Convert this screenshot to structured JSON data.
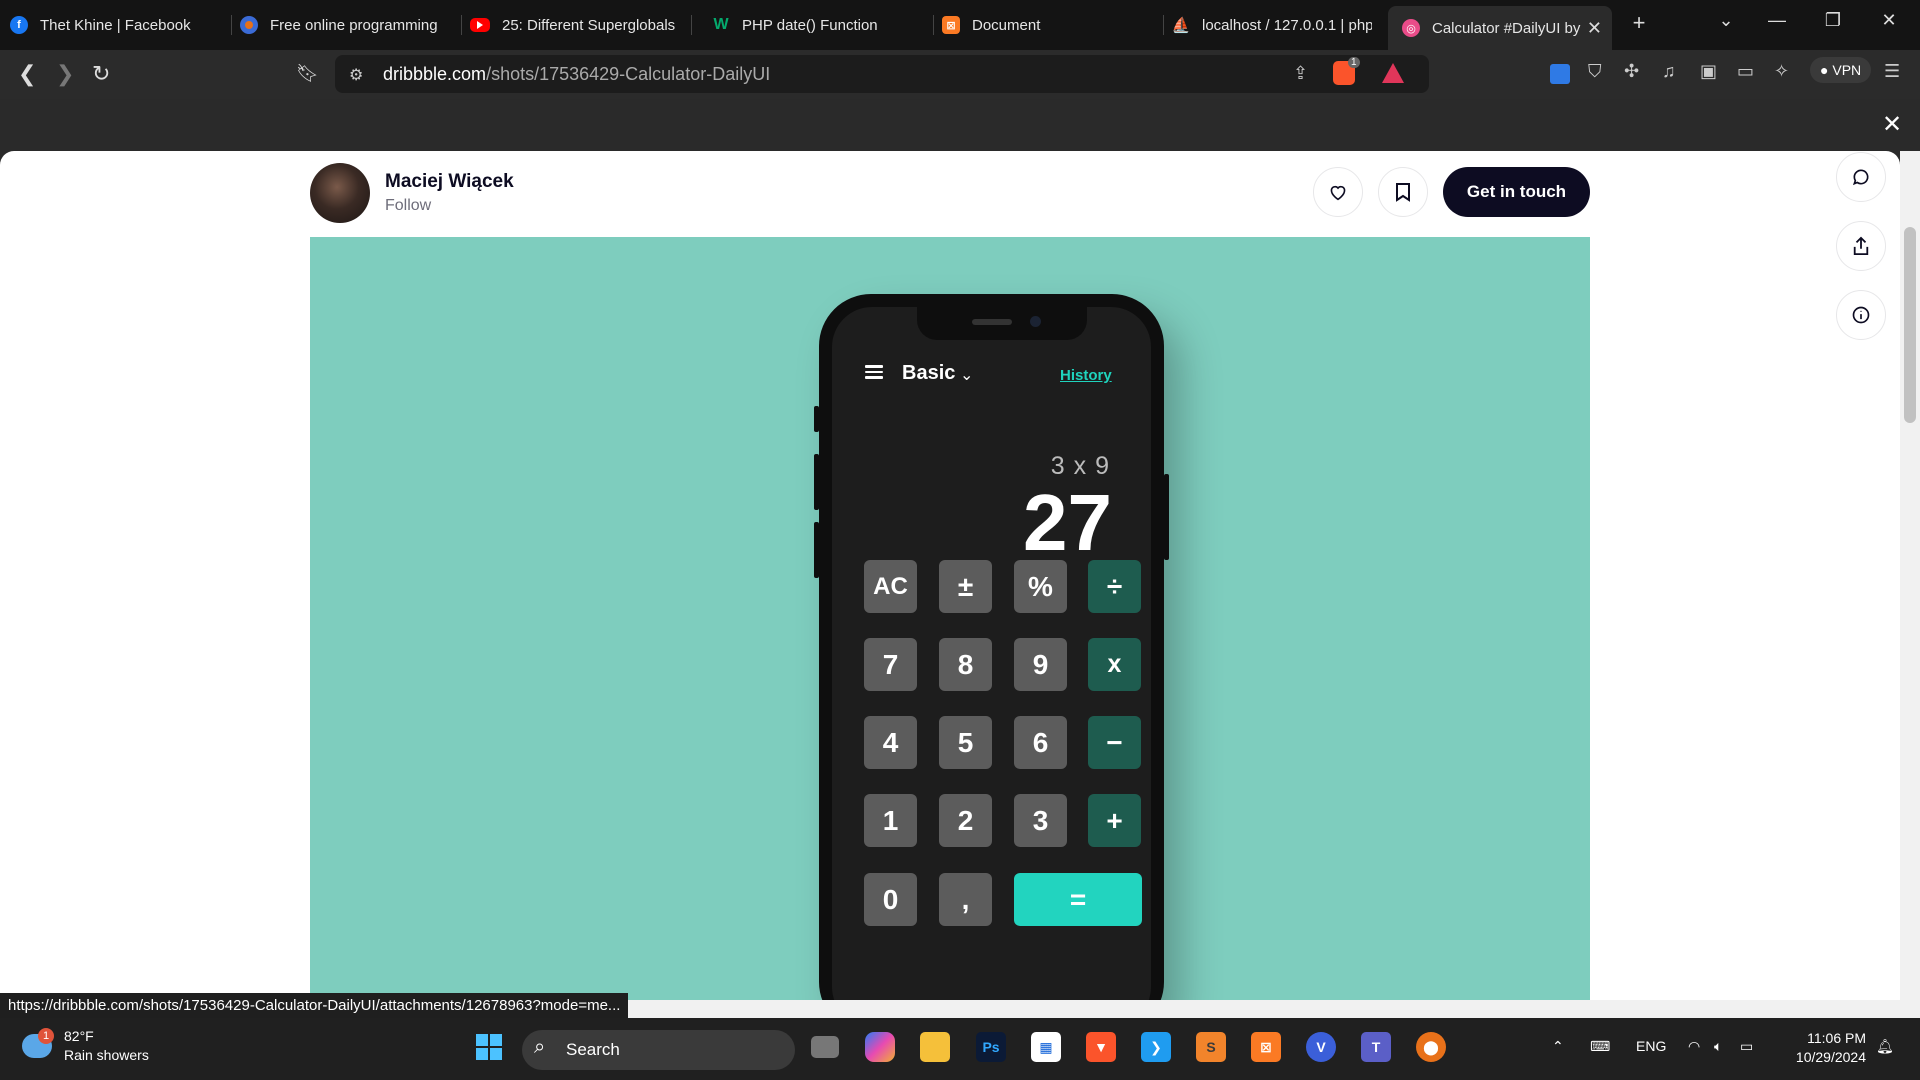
{
  "browser": {
    "tabs": [
      {
        "title": "Thet Khine | Facebook",
        "icon": "facebook-icon",
        "color": "#1877f2"
      },
      {
        "title": "Free online programming",
        "icon": "globe-icon",
        "color": "#e8711a"
      },
      {
        "title": "25: Different Superglobals",
        "icon": "youtube-icon",
        "color": "#ff0000"
      },
      {
        "title": "PHP date() Function",
        "icon": "w3schools-icon",
        "color": "#04aa6d"
      },
      {
        "title": "Document",
        "icon": "xampp-icon",
        "color": "#fb7a24"
      },
      {
        "title": "localhost / 127.0.0.1 | php",
        "icon": "phpmyadmin-icon",
        "color": "#f89c0e"
      },
      {
        "title": "Calculator #DailyUI by",
        "icon": "dribbble-icon",
        "color": "#ea4c89"
      }
    ],
    "url_host": "dribbble.com",
    "url_path": "/shots/17536429-Calculator-DailyUI",
    "shields_badge": "1",
    "vpn_label": "VPN",
    "status_url": "https://dribbble.com/shots/17536429-Calculator-DailyUI/attachments/12678963?mode=me..."
  },
  "shot": {
    "author": "Maciej Wiącek",
    "follow_label": "Follow",
    "cta_label": "Get in touch",
    "background_color": "#7ecdbe"
  },
  "calculator": {
    "mode": "Basic",
    "history_label": "History",
    "expression": "3 x 9",
    "result": "27",
    "keys": [
      [
        "AC",
        "±",
        "%",
        "÷"
      ],
      [
        "7",
        "8",
        "9",
        "x"
      ],
      [
        "4",
        "5",
        "6",
        "−"
      ],
      [
        "1",
        "2",
        "3",
        "+"
      ],
      [
        "0",
        ",",
        "="
      ]
    ],
    "accent_color": "#22d4bf",
    "operator_color": "#1e5c4f"
  },
  "taskbar": {
    "weather_badge": "1",
    "temperature": "82°F",
    "weather_desc": "Rain showers",
    "search_label": "Search",
    "language": "ENG",
    "time": "11:06 PM",
    "date": "10/29/2024"
  }
}
